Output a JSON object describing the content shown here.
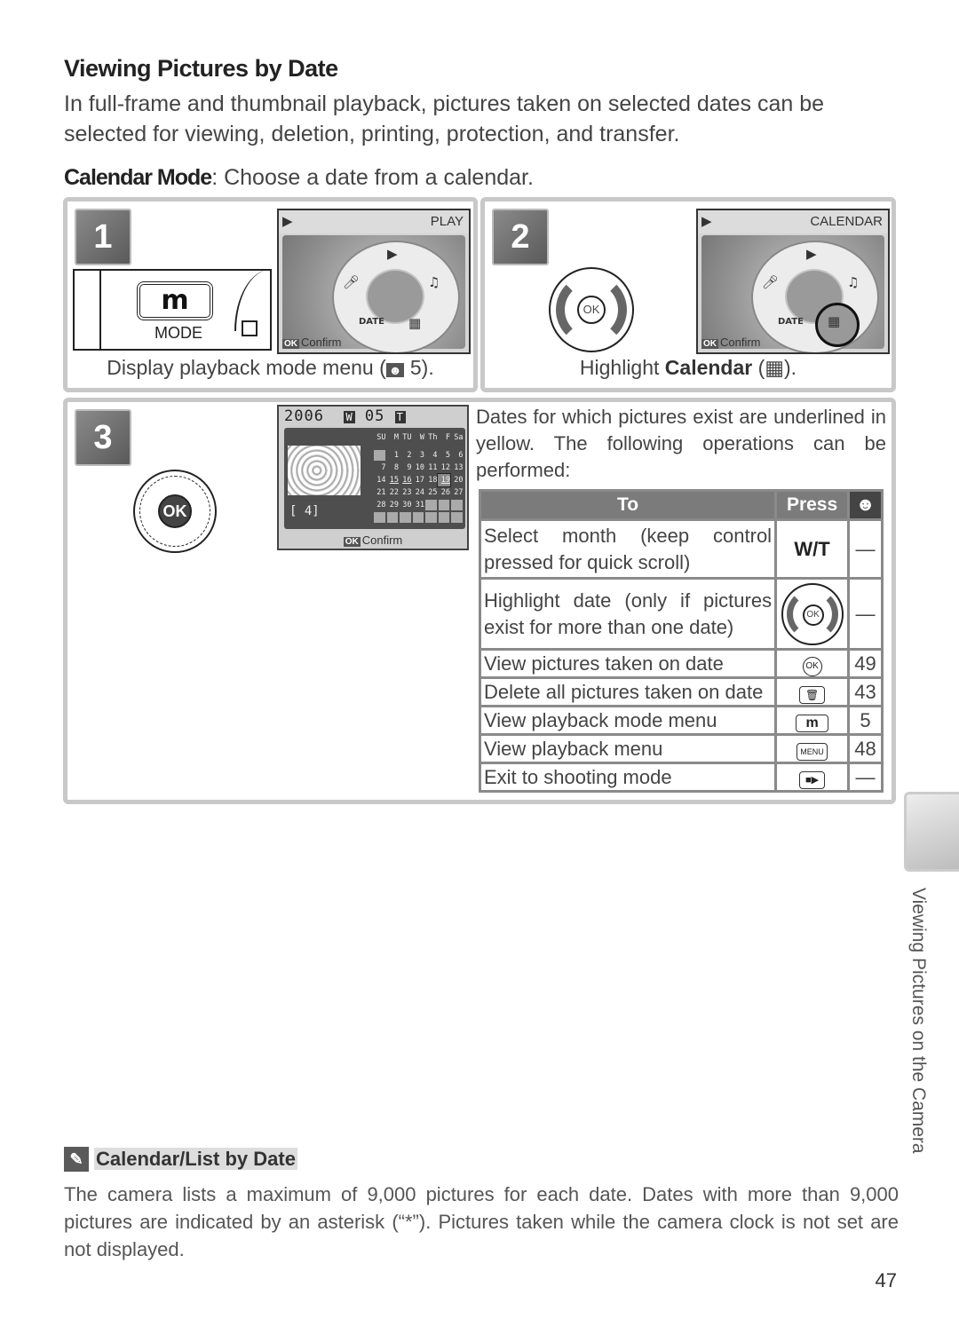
{
  "page": {
    "title": "Viewing Pictures by Date",
    "intro": "In full-frame and thumbnail playback, pictures taken on selected dates can be selected for viewing, deletion, printing, protection, and transfer.",
    "calendar_mode_label": "Calendar Mode",
    "calendar_mode_text": ": Choose a date from a calendar.",
    "page_number": "47",
    "side_tab_text": "Viewing Pictures on the Camera"
  },
  "steps": [
    {
      "number": "1",
      "caption_prefix": "Display playback mode menu (",
      "caption_ref_icon": "reference-eye-icon",
      "caption_suffix": " 5).",
      "button_label": "m",
      "button_caption": "MODE",
      "screen_title": "PLAY",
      "screen_confirm": "Confirm"
    },
    {
      "number": "2",
      "caption_prefix": "Highlight ",
      "caption_bold": "Calendar",
      "caption_suffix": " (▦).",
      "dial_center": "OK",
      "screen_title": "CALENDAR",
      "screen_confirm": "Confirm"
    },
    {
      "number": "3",
      "dial_center": "OK",
      "calendar_screen": {
        "year": "2006",
        "month": "05",
        "zoom_w": "W",
        "zoom_t": "T",
        "count": "[ 4]",
        "confirm": "Confirm",
        "weekdays": [
          "SU",
          "M",
          "TU",
          "W",
          "Th",
          "F",
          "Sa"
        ],
        "weeks": [
          [
            "",
            "1",
            "2",
            "3",
            "4",
            "5",
            "6"
          ],
          [
            "7",
            "8",
            "9",
            "10",
            "11",
            "12",
            "13"
          ],
          [
            "14",
            "15",
            "16",
            "17",
            "18",
            "19",
            "20"
          ],
          [
            "21",
            "22",
            "23",
            "24",
            "25",
            "26",
            "27"
          ],
          [
            "28",
            "29",
            "30",
            "31",
            "",
            "",
            ""
          ],
          [
            "",
            "",
            "",
            "",
            "",
            "",
            ""
          ]
        ],
        "underlined_dates": [
          "15",
          "16",
          "19"
        ],
        "selected_date": "19"
      },
      "description": "Dates for which pictures exist are underlined in yellow.  The following operations can be performed:"
    }
  ],
  "operations_table": {
    "headers": {
      "to": "To",
      "press": "Press",
      "ref": "reference-eye-icon"
    },
    "rows": [
      {
        "to": "Select month (keep control pressed for quick scroll)",
        "press": "W/T",
        "press_icon": "zoom-wt-button",
        "ref": "—"
      },
      {
        "to": "Highlight date (only if pictures exist for more than one date)",
        "press": "",
        "press_icon": "rotary-multi-selector-icon",
        "ref": "—"
      },
      {
        "to": "View pictures taken on date",
        "press": "OK",
        "press_icon": "ok-button-icon",
        "ref": "49"
      },
      {
        "to": "Delete all pictures taken on date",
        "press": "🗑",
        "press_icon": "trash-button-icon",
        "ref": "43"
      },
      {
        "to": "View playback mode menu",
        "press": "m",
        "press_icon": "mode-button-icon",
        "ref": "5"
      },
      {
        "to": "View playback menu",
        "press": "MENU",
        "press_icon": "menu-button-icon",
        "ref": "48"
      },
      {
        "to": "Exit to shooting mode",
        "press": "■▶",
        "press_icon": "shooting-playback-button-icon",
        "ref": "—"
      }
    ]
  },
  "note": {
    "title": "Calendar/List by Date",
    "icon": "pencil-note-icon",
    "body": "The camera lists a maximum of 9,000 pictures for each date.  Dates with more than 9,000 pictures are indicated by an asterisk (“*”).  Pictures taken while the camera clock is not set are not displayed."
  }
}
